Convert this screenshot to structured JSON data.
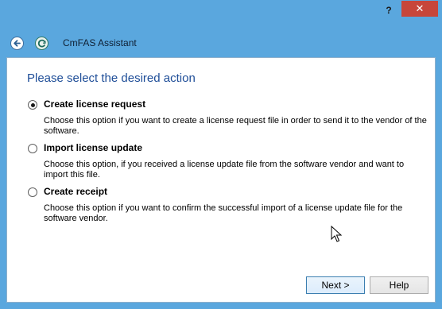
{
  "titlebar": {
    "help_label": "?",
    "close_label": "✕"
  },
  "navbar": {
    "app_title": "CmFAS Assistant"
  },
  "main": {
    "heading": "Please select the desired action",
    "options": [
      {
        "label": "Create license request",
        "description": "Choose this option if you want to create a license request file in order to send it to the vendor of the software.",
        "selected": true
      },
      {
        "label": "Import license update",
        "description": "Choose this option, if you received a license update file from the software vendor and want to import this file.",
        "selected": false
      },
      {
        "label": "Create receipt",
        "description": "Choose this option if you want to confirm the successful import of a license update file for the software vendor.",
        "selected": false
      }
    ]
  },
  "buttons": {
    "next_label": "Next >",
    "help_label": "Help"
  },
  "colors": {
    "chrome": "#5aa7de",
    "close": "#c7463a",
    "heading": "#1f4e98"
  }
}
